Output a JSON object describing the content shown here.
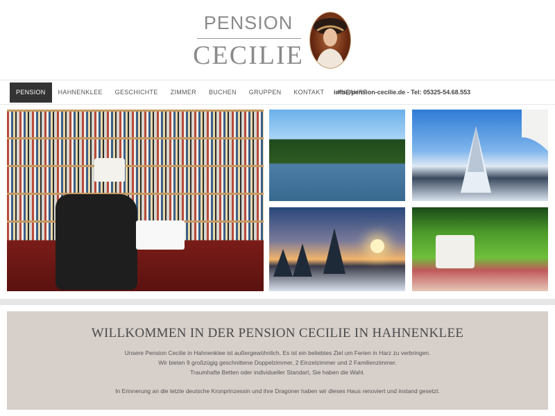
{
  "logo": {
    "line1": "PENSION",
    "line2": "CECILIE",
    "portrait_icon": "woman-portrait-icon"
  },
  "nav": {
    "items": [
      {
        "label": "PENSION",
        "active": true
      },
      {
        "label": "HAHNENKLEE",
        "active": false
      },
      {
        "label": "GESCHICHTE",
        "active": false
      },
      {
        "label": "ZIMMER",
        "active": false
      },
      {
        "label": "BUCHEN",
        "active": false
      },
      {
        "label": "GRUPPEN",
        "active": false
      },
      {
        "label": "KONTAKT",
        "active": false
      },
      {
        "label": "ANFAHRT",
        "active": false
      }
    ],
    "contact": "info@pension-cecilie.de - Tel: 05325-54.68.553"
  },
  "images": [
    {
      "name": "library-image"
    },
    {
      "name": "lake-forest-image"
    },
    {
      "name": "snowy-tree-image"
    },
    {
      "name": "winter-sunset-image"
    },
    {
      "name": "picnic-image"
    }
  ],
  "welcome": {
    "title": "WILLKOMMEN IN DER PENSION CECILIE IN HAHNENKLEE",
    "line1": "Unsere Pension Cecilie in Hahnenklee ist außergewöhnlich. Es ist ein beliebtes Ziel um Ferien in Harz zu verbringen.",
    "line2": "Wir bieten 9 großzügig geschnittene Doppelzimmer, 2 Einzelzimmer und 2 Familienzimmer.",
    "line3": "Traumhafte Betten oder individueller Standart, Sie haben die Wahl.",
    "line4": "In Erinnerung an die letzte deutsche Kronprinzessin und ihre Dragoner haben wir dieses Haus renoviert und instand gesetzt."
  },
  "colors": {
    "nav_active_bg": "#333333",
    "welcome_bg": "#d7cfca",
    "logo_text": "#8a8a8a"
  }
}
